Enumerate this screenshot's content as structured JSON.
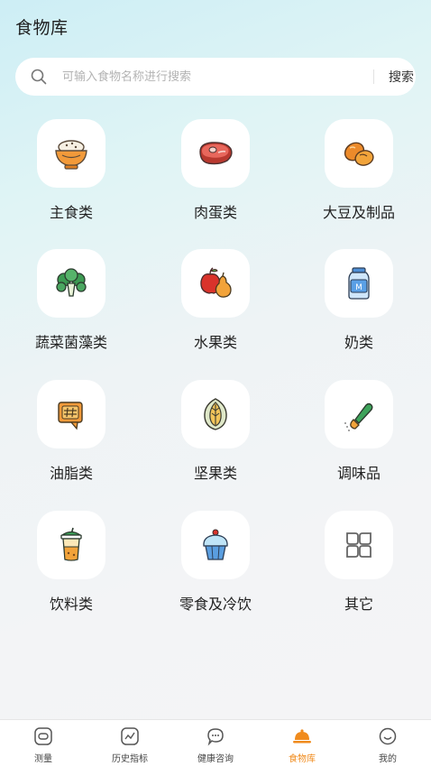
{
  "header": {
    "title": "食物库"
  },
  "search": {
    "placeholder": "可输入食物名称进行搜索",
    "button_label": "搜索"
  },
  "categories": [
    {
      "label": "主食类",
      "icon": "rice-bowl-icon"
    },
    {
      "label": "肉蛋类",
      "icon": "meat-icon"
    },
    {
      "label": "大豆及制品",
      "icon": "soybean-icon"
    },
    {
      "label": "蔬菜菌藻类",
      "icon": "vegetable-icon"
    },
    {
      "label": "水果类",
      "icon": "fruit-icon"
    },
    {
      "label": "奶类",
      "icon": "milk-icon"
    },
    {
      "label": "油脂类",
      "icon": "oil-icon"
    },
    {
      "label": "坚果类",
      "icon": "nut-icon"
    },
    {
      "label": "调味品",
      "icon": "seasoning-icon"
    },
    {
      "label": "饮料类",
      "icon": "drink-icon"
    },
    {
      "label": "零食及冷饮",
      "icon": "cupcake-icon"
    },
    {
      "label": "其它",
      "icon": "other-icon"
    }
  ],
  "tabbar": {
    "active": "食物库",
    "accent_color": "#f08b1d",
    "items": [
      {
        "label": "测量",
        "icon": "measure-icon"
      },
      {
        "label": "历史指标",
        "icon": "history-chart-icon"
      },
      {
        "label": "健康咨询",
        "icon": "chat-icon"
      },
      {
        "label": "食物库",
        "icon": "food-cloche-icon"
      },
      {
        "label": "我的",
        "icon": "profile-icon"
      }
    ]
  }
}
